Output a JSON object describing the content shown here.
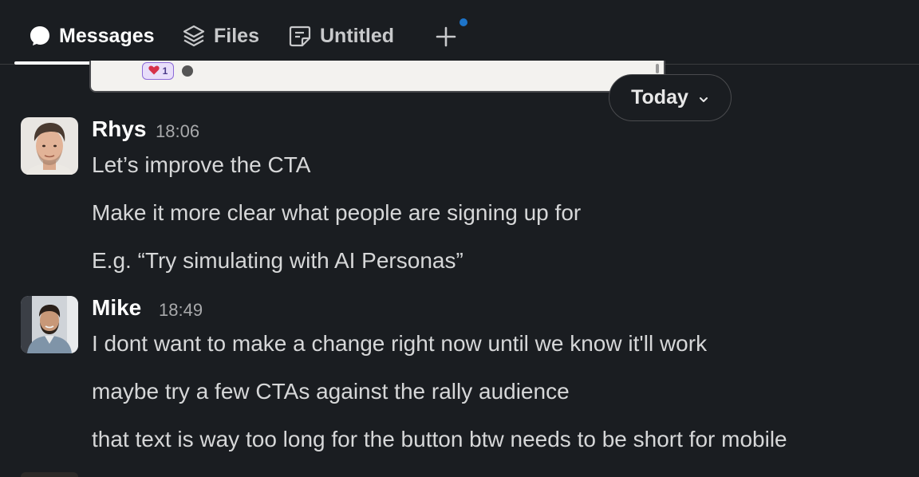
{
  "tabs": [
    {
      "label": "Messages",
      "icon": "message-bubble-icon",
      "active": true
    },
    {
      "label": "Files",
      "icon": "layers-icon",
      "active": false
    },
    {
      "label": "Untitled",
      "icon": "canvas-note-icon",
      "active": false
    }
  ],
  "add_tab": {
    "icon": "plus-icon",
    "indicator_color": "#1d74c9"
  },
  "attachment": {
    "reaction_count": "1",
    "reaction_icon": "heart-icon"
  },
  "date_divider": {
    "label": "Today",
    "icon": "chevron-down-icon"
  },
  "messages": [
    {
      "sender": "Rhys",
      "time": "18:06",
      "lines": [
        "Let’s improve the CTA",
        "Make it more clear what people are signing up for",
        "E.g. “Try simulating with AI Personas”"
      ]
    },
    {
      "sender": "Mike",
      "time": "18:49",
      "lines": [
        "I dont want to make a change right now until we know it'll work",
        "maybe try a few CTAs against the rally audience",
        "that text is way too long for the button btw needs to be short for mobile"
      ]
    }
  ],
  "colors": {
    "background": "#1a1d21",
    "text": "#d1d2d3",
    "accent_dot": "#1d74c9"
  }
}
